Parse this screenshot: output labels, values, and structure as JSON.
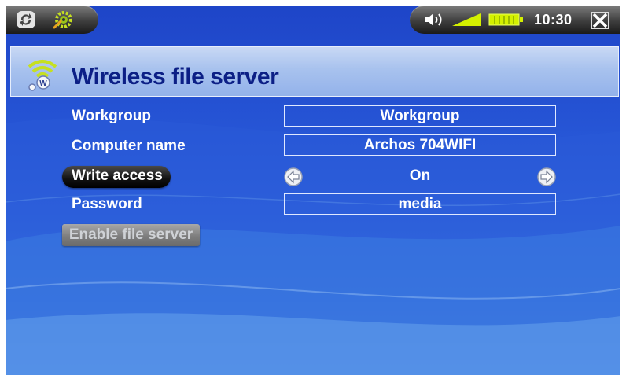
{
  "statusbar": {
    "time": "10:30",
    "battery_icon": "battery-icon",
    "signal_icon": "signal-strength-icon",
    "volume_icon": "speaker-icon"
  },
  "page": {
    "title": "Wireless file server",
    "title_icon": "wifi-server-icon"
  },
  "settings": {
    "workgroup": {
      "label": "Workgroup",
      "value": "Workgroup"
    },
    "computer_name": {
      "label": "Computer name",
      "value": "Archos 704WIFI"
    },
    "write_access": {
      "label": "Write access",
      "value": "On"
    },
    "password": {
      "label": "Password",
      "value": "media"
    }
  },
  "actions": {
    "enable_label": "Enable file server"
  },
  "colors": {
    "background": "#2553d4",
    "title_text": "#0c1f86",
    "title_bar": "#a8c2ee"
  }
}
